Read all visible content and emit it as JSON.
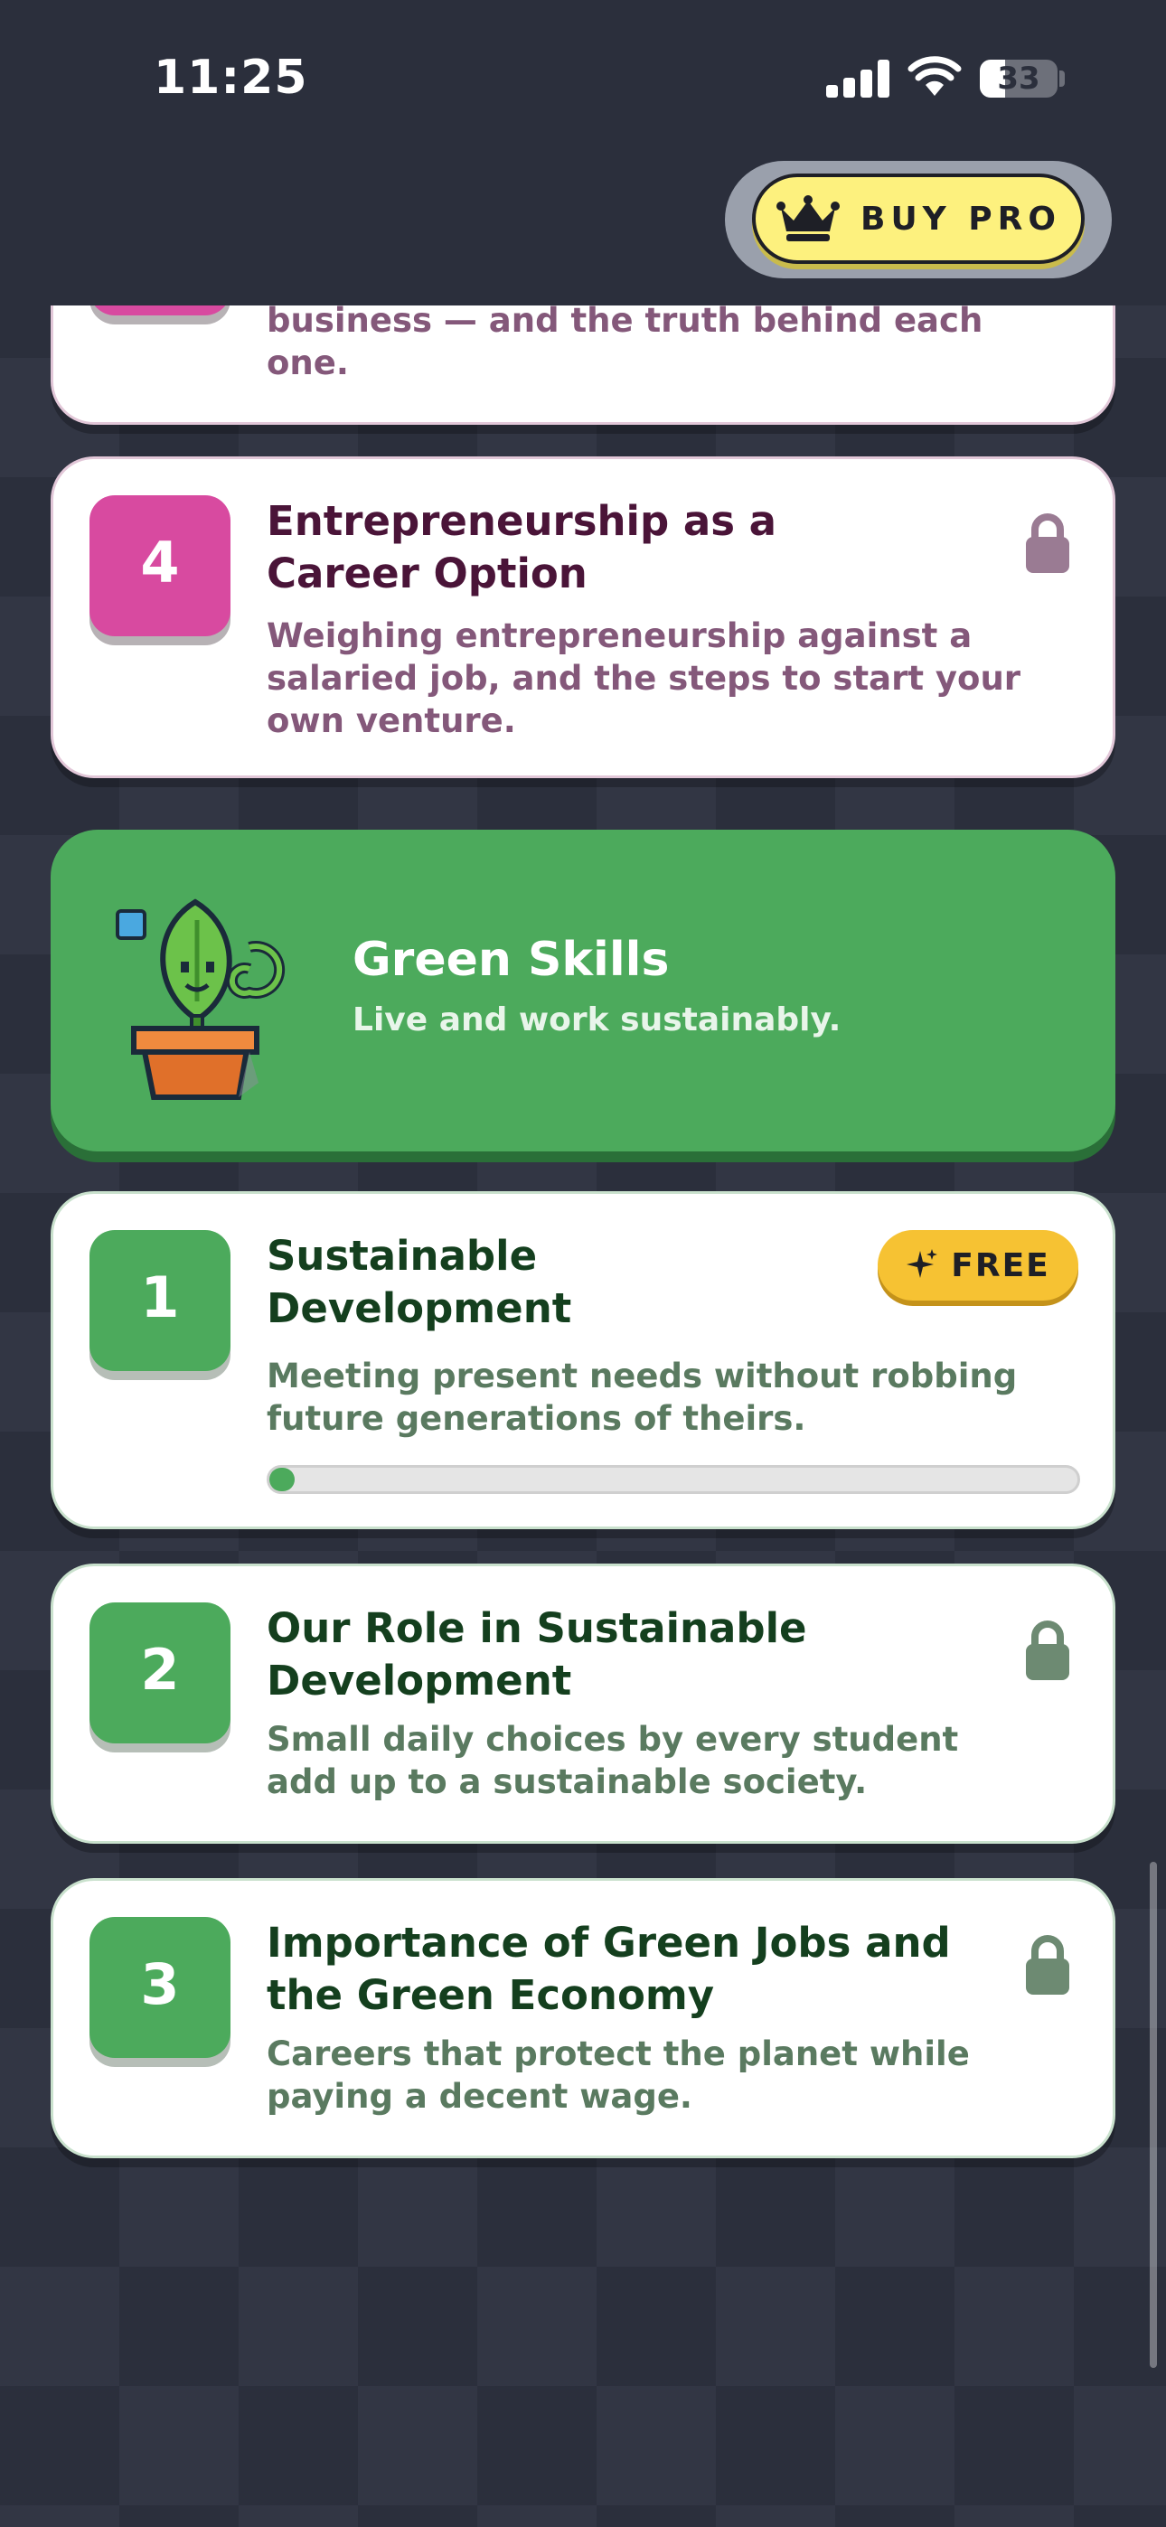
{
  "status_bar": {
    "time": "11:25",
    "battery": "33",
    "battery_level": 0.33
  },
  "header": {
    "buy_pro_label": "BUY PRO",
    "buy_pro_icon": "crown-icon"
  },
  "previous_card": {
    "desc_tail_line1": "business — and the truth behind each",
    "desc_tail_line2": "one."
  },
  "entrepreneurship_lesson": {
    "number": "4",
    "title_line1": "Entrepreneurship as a",
    "title_line2": "Career Option",
    "desc_line1": "Weighing entrepreneurship against a",
    "desc_line2": "salaried job, and the steps to start your",
    "desc_line3": "own venture.",
    "icon": "lock-icon"
  },
  "section": {
    "title": "Green Skills",
    "subtitle": "Live and work sustainably.",
    "mascot_icon": "potted-plant-mascot-icon",
    "accent": "#4caa5c"
  },
  "lessons": [
    {
      "number": "1",
      "title_line1": "Sustainable",
      "title_line2": "Development",
      "desc_line1": "Meeting present needs without robbing",
      "desc_line2": "future generations of theirs.",
      "badge": "FREE",
      "badge_icon": "sparkle-icon",
      "progress": 0.03
    },
    {
      "number": "2",
      "title_line1": "Our Role in Sustainable",
      "title_line2": "Development",
      "desc_line1": "Small daily choices by every student",
      "desc_line2": "add up to a sustainable society.",
      "icon": "lock-icon"
    },
    {
      "number": "3",
      "title_line1": "Importance of Green Jobs and",
      "title_line2": "the Green Economy",
      "desc_line1": "Careers that protect the planet while",
      "desc_line2": "paying a decent wage.",
      "icon": "lock-icon"
    }
  ],
  "colors": {
    "pink": "#d84aa0",
    "green": "#4caa5c",
    "pro_yellow": "#fdf17e",
    "free_yellow": "#f6c233"
  }
}
